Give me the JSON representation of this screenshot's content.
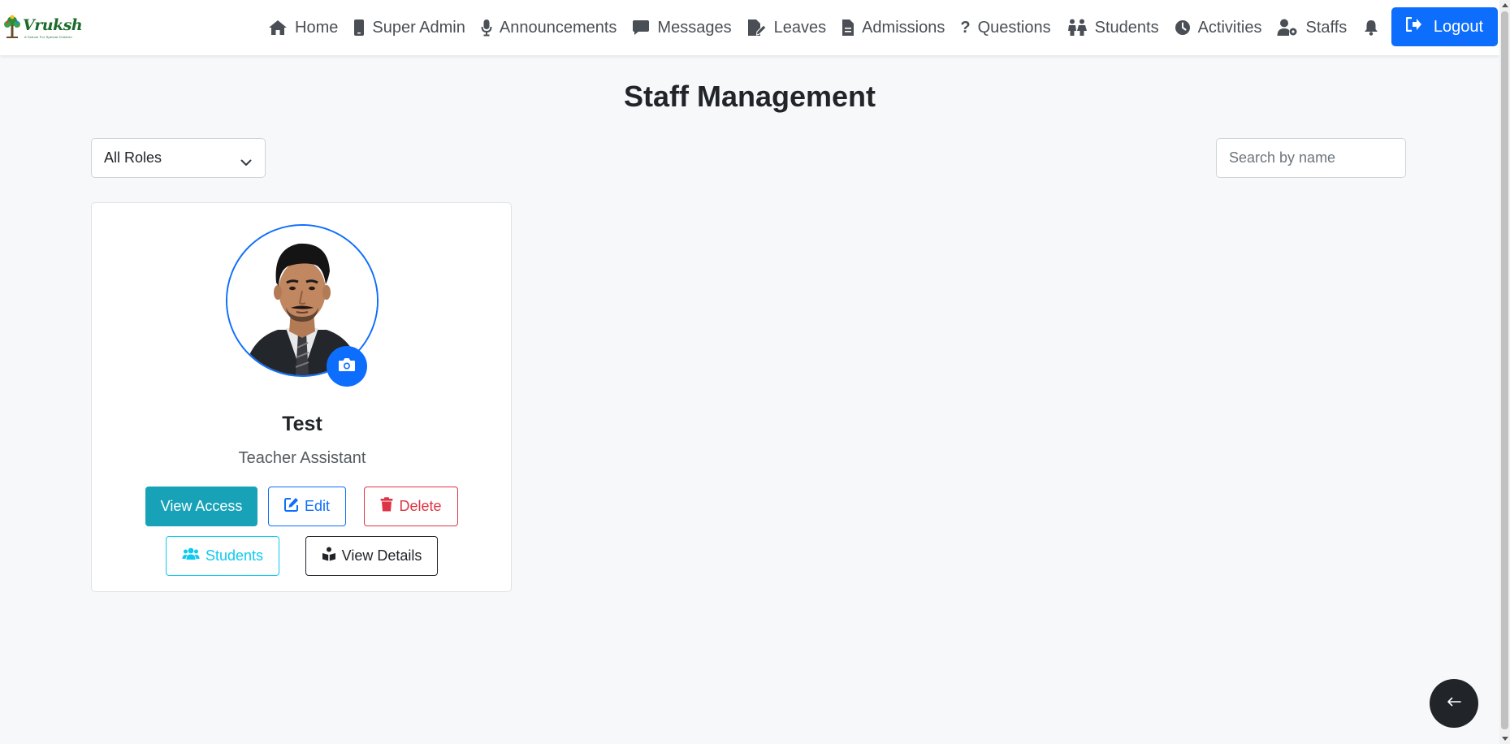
{
  "brand": {
    "name": "Vruksh",
    "tagline": "A School For Special Children"
  },
  "nav": {
    "items": [
      {
        "label": "Home",
        "icon": "home-icon"
      },
      {
        "label": "Super Admin",
        "icon": "mobile-icon"
      },
      {
        "label": "Announcements",
        "icon": "microphone-icon"
      },
      {
        "label": "Messages",
        "icon": "comment-icon"
      },
      {
        "label": "Leaves",
        "icon": "file-edit-icon"
      },
      {
        "label": "Admissions",
        "icon": "file-icon"
      },
      {
        "label": "Questions",
        "icon": "question-icon"
      },
      {
        "label": "Students",
        "icon": "children-icon"
      },
      {
        "label": "Activities",
        "icon": "clock-icon"
      },
      {
        "label": "Staffs",
        "icon": "user-gear-icon"
      }
    ],
    "notifications_icon": "bell-icon",
    "logout_label": "Logout"
  },
  "page": {
    "title": "Staff Management"
  },
  "filters": {
    "role_selected": "All Roles",
    "search_placeholder": "Search by name",
    "search_value": ""
  },
  "staff": [
    {
      "name": "Test",
      "role": "Teacher Assistant",
      "buttons": {
        "view_access": "View Access",
        "edit": "Edit",
        "delete": "Delete",
        "students": "Students",
        "view_details": "View Details"
      }
    }
  ],
  "colors": {
    "primary": "#0d6efd",
    "info": "#17a2b8",
    "cyan": "#0dcaf0",
    "danger": "#dc3545",
    "dark": "#212529",
    "background": "#f7f8fa"
  },
  "back_button_icon": "arrow-left-icon"
}
